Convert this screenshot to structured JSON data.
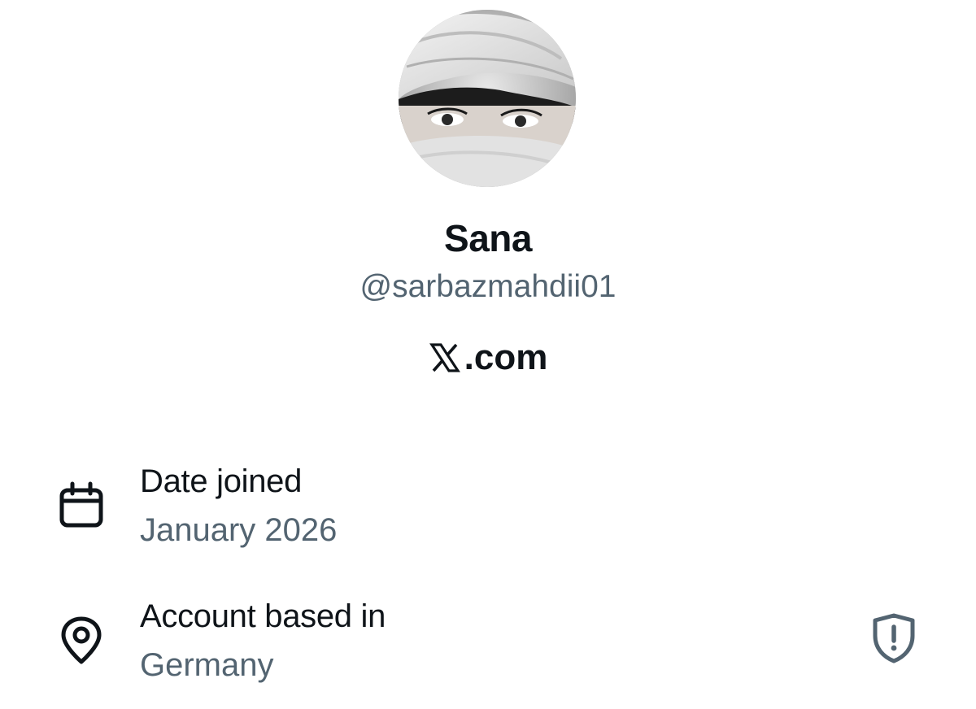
{
  "profile": {
    "display_name": "Sana",
    "handle": "@sarbazmahdii01",
    "site": ".com",
    "site_logo_icon": "x-logo-icon",
    "avatar": "avatar-photo-grayscale"
  },
  "details": {
    "joined": {
      "icon": "calendar-icon",
      "label": "Date joined",
      "value": "January 2026"
    },
    "location": {
      "icon": "location-pin-icon",
      "label": "Account based in",
      "value": "Germany",
      "action_icon": "shield-alert-icon"
    }
  },
  "colors": {
    "text_primary": "#0f1419",
    "text_secondary": "#536471",
    "background": "#ffffff"
  }
}
